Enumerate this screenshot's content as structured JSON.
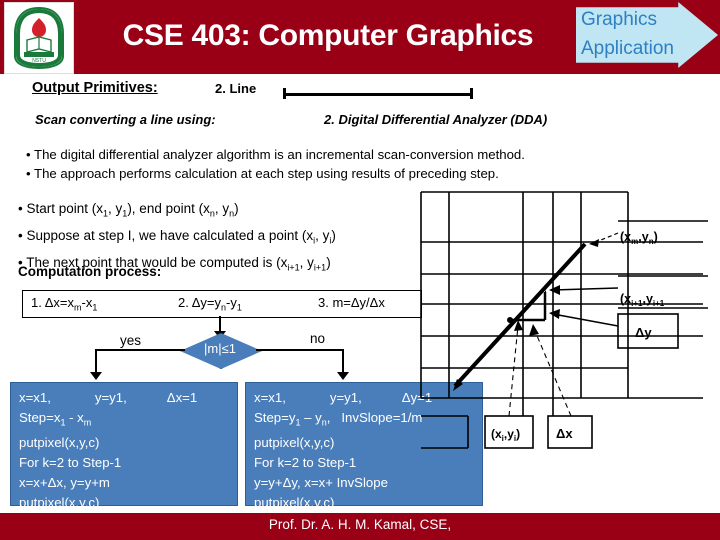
{
  "header": {
    "title": "CSE 403: Computer Graphics",
    "logo_alt": "university-crest",
    "callout": {
      "line1": "Graphics",
      "line2": "Application"
    },
    "bg_color": "#990016",
    "callout_bg": "#bfe6f2",
    "callout_text_color": "#2f7fc4"
  },
  "slide": {
    "section_label": "Output Primitives:",
    "topic_number": "2. Line",
    "scan_label": "Scan converting a line using:",
    "method_label": "2.   Digital Differential Analyzer (DDA)",
    "intro_bullets": [
      "• The digital differential analyzer algorithm is an incremental scan-conversion method.",
      "• The approach performs calculation at each step using results of preceding step."
    ],
    "definition_bullets": [
      "• Start point (x1, y1), end point (xn, yn)",
      "• Suppose at step I, we have calculated a point (xi, yi)",
      "• The next point that would be computed is (xi+1, yi+1)"
    ],
    "computation_label": "Computation process:"
  },
  "flow": {
    "step_box": {
      "step1": "1. Δx=xm-x1",
      "step2": "2. Δy=yn-y1",
      "step3": "3. m=Δy/Δx"
    },
    "decision_label": "|m|≤1",
    "branch_yes": "yes",
    "branch_no": "no",
    "box_fill": "#4a7ebb",
    "box_stroke": "#2e5f96",
    "code_left": {
      "l1a": "x=x1,",
      "l1b": "y=y1,",
      "l1c": "Δx=1",
      "l2": "Step=x1 - xm",
      "l3": "putpixel(x,y,c)",
      "l4": "For k=2 to Step-1",
      "l5": "x=x+Δx, y=y+m",
      "l6": "putpixel(x,y,c)"
    },
    "code_right": {
      "l1a": "x=x1,",
      "l1b": "y=y1,",
      "l1c": "Δy=1",
      "l2a": "Step=y1 – yn,",
      "l2b": "InvSlope=1/m",
      "l3": "putpixel(x,y,c)",
      "l4": "For k=2 to Step-1",
      "l5": "y=y+Δy, x=x+ InvSlope",
      "l6": "putpixel(x,y,c)"
    }
  },
  "diagram": {
    "label_end": "(xm,yn)",
    "label_next": "(xi+1,yi+1",
    "label_dy": "Δy",
    "label_current": "(xi,yi)",
    "label_dx": "Δx"
  },
  "footer": {
    "text": "Prof. Dr. A. H. M. Kamal, CSE,",
    "bg_color": "#990016"
  }
}
